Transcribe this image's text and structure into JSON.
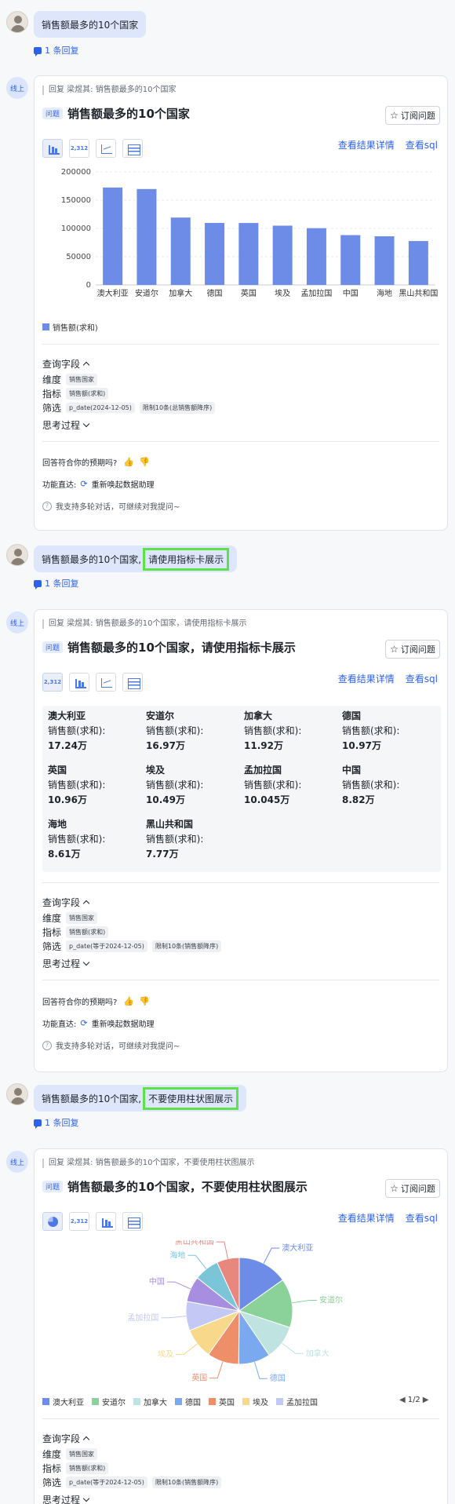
{
  "conversation": [
    {
      "question": "销售额最多的10个国家",
      "highlight": "",
      "reply_count": "1 条回复"
    },
    {
      "question": "销售额最多的10个国家,",
      "highlight": "请使用指标卡展示",
      "reply_count": "1 条回复"
    },
    {
      "question": "销售额最多的10个国家,",
      "highlight": "不要使用柱状图展示",
      "reply_count": "1 条回复"
    }
  ],
  "bot_label": "线上",
  "common": {
    "subscribe": "订阅问题",
    "view_detail": "查看结果详情",
    "view_sql": "查看sql",
    "question_tag": "问题",
    "query_fields": "查询字段",
    "dimension_label": "维度",
    "dimension_value": "销售国家",
    "metric_label": "指标",
    "metric_value": "销售额(求和)",
    "filter_label": "筛选",
    "thinking": "思考过程",
    "feedback_question": "回答符合你的预期吗?",
    "func_label": "功能直达:",
    "func_action": "重新唤起数据助理",
    "hint": "我支持多轮对话，可继续对我提问~",
    "legend_label": "销售额(求和)",
    "toolbar_num": "2,312"
  },
  "answers": [
    {
      "quote": "回复 梁煜其:  销售额最多的10个国家",
      "title": "销售额最多的10个国家",
      "filter_tags": [
        "p_date(2024-12-05)",
        "限制10条(总销售额降序)"
      ]
    },
    {
      "quote": "回复 梁煜其:  销售额最多的10个国家，请使用指标卡展示",
      "title": "销售额最多的10个国家，请使用指标卡展示",
      "filter_tags": [
        "p_date(等于2024-12-05)",
        "限制10条(销售额降序)"
      ],
      "cards": [
        {
          "name": "澳大利亚",
          "label": "销售额(求和):",
          "value": "17.24万"
        },
        {
          "name": "安道尔",
          "label": "销售额(求和):",
          "value": "16.97万"
        },
        {
          "name": "加拿大",
          "label": "销售额(求和):",
          "value": "11.92万"
        },
        {
          "name": "德国",
          "label": "销售额(求和):",
          "value": "10.97万"
        },
        {
          "name": "英国",
          "label": "销售额(求和):",
          "value": "10.96万"
        },
        {
          "name": "埃及",
          "label": "销售额(求和):",
          "value": "10.49万"
        },
        {
          "name": "孟加拉国",
          "label": "销售额(求和):",
          "value": "10.045万"
        },
        {
          "name": "中国",
          "label": "销售额(求和):",
          "value": "8.82万"
        },
        {
          "name": "海地",
          "label": "销售额(求和):",
          "value": "8.61万"
        },
        {
          "name": "黑山共和国",
          "label": "销售额(求和):",
          "value": "7.77万"
        }
      ]
    },
    {
      "quote": "回复 梁煜其:  销售额最多的10个国家，不要使用柱状图展示",
      "title": "销售额最多的10个国家，不要使用柱状图展示",
      "filter_tags": [
        "p_date(等于2024-12-05)",
        "限制10条(销售额降序)"
      ],
      "pager": "1/2"
    }
  ],
  "chart_data": [
    {
      "type": "bar",
      "categories": [
        "澳大利亚",
        "安道尔",
        "加拿大",
        "德国",
        "英国",
        "埃及",
        "孟加拉国",
        "中国",
        "海地",
        "黑山共和国"
      ],
      "series": [
        {
          "name": "销售额(求和)",
          "values": [
            172400,
            169700,
            119200,
            109700,
            109600,
            104900,
            100450,
            88200,
            86100,
            77700
          ]
        }
      ],
      "yticks": [
        0,
        50000,
        100000,
        150000,
        200000
      ],
      "ylim": [
        0,
        200000
      ],
      "grid": true,
      "legend": "bottom-left",
      "color": "#6d8ce8"
    },
    {
      "type": "pie",
      "categories": [
        "澳大利亚",
        "安道尔",
        "加拿大",
        "德国",
        "英国",
        "埃及",
        "孟加拉国",
        "中国",
        "海地",
        "黑山共和国"
      ],
      "values": [
        172400,
        169700,
        119200,
        109700,
        109600,
        104900,
        100450,
        88200,
        86100,
        77700
      ],
      "colors": [
        "#6d8ce8",
        "#8ad29a",
        "#bfe3e0",
        "#7aa9f0",
        "#ee8f6a",
        "#f8d98c",
        "#c3c8f4",
        "#a78ee0",
        "#7ac6d8",
        "#e7877e"
      ],
      "legend_visible": [
        "澳大利亚",
        "安道尔",
        "加拿大",
        "德国",
        "英国",
        "埃及",
        "孟加拉国"
      ],
      "legend": "bottom"
    }
  ]
}
